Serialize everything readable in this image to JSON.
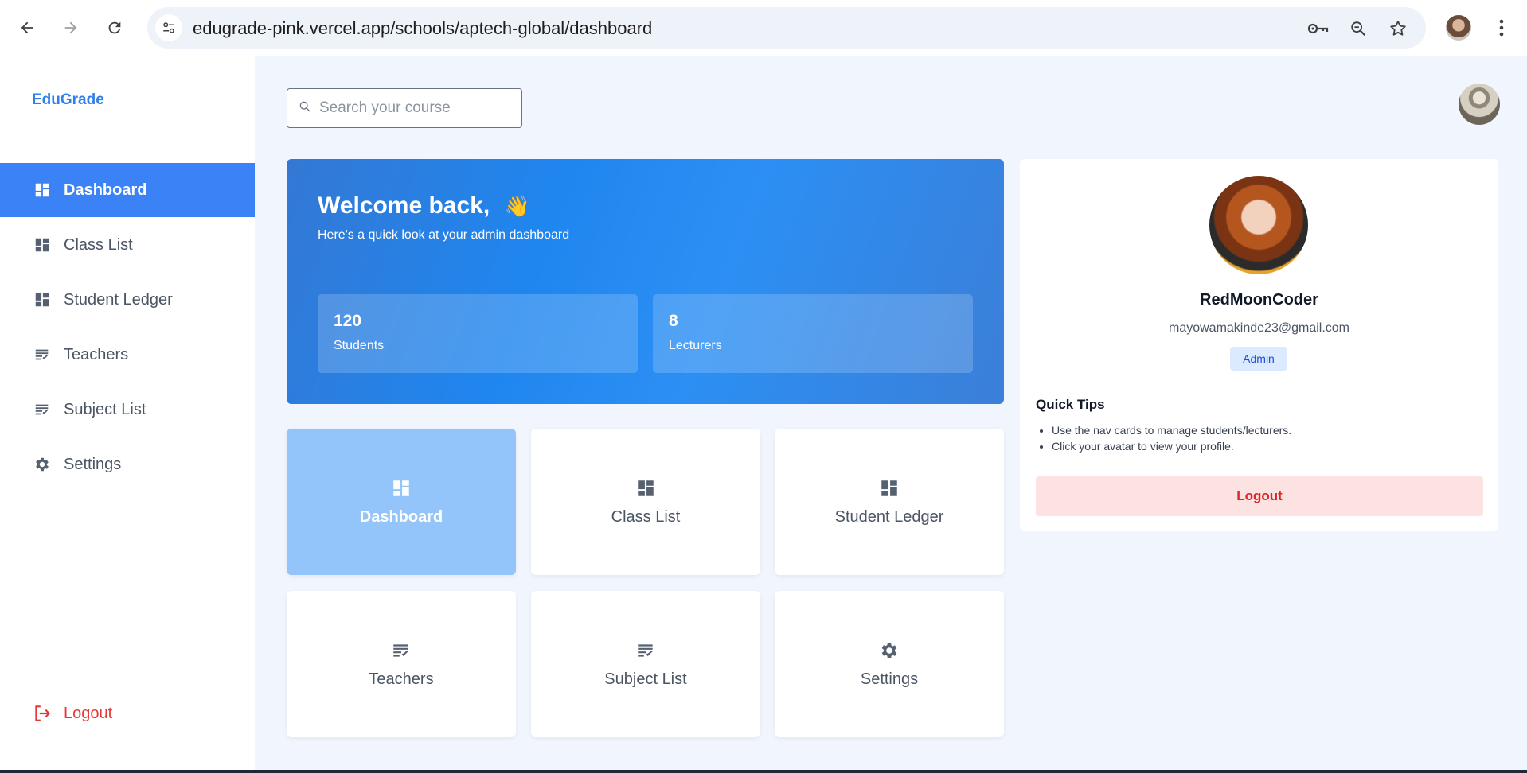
{
  "browser": {
    "url": "edugrade-pink.vercel.app/schools/aptech-global/dashboard",
    "icons": [
      "back-icon",
      "forward-icon",
      "reload-icon",
      "site-settings-icon",
      "password-key-icon",
      "zoom-icon",
      "bookmark-star-icon",
      "profile-avatar",
      "menu-kebab-icon"
    ]
  },
  "sidebar": {
    "brand": "EduGrade",
    "items": [
      {
        "label": "Dashboard",
        "icon": "dashboard-icon",
        "active": true
      },
      {
        "label": "Class List",
        "icon": "dashboard-icon",
        "active": false
      },
      {
        "label": "Student Ledger",
        "icon": "dashboard-icon",
        "active": false
      },
      {
        "label": "Teachers",
        "icon": "list-check-icon",
        "active": false
      },
      {
        "label": "Subject List",
        "icon": "list-check-icon",
        "active": false
      },
      {
        "label": "Settings",
        "icon": "gear-icon",
        "active": false
      }
    ],
    "logout": "Logout"
  },
  "search": {
    "placeholder": "Search your course",
    "value": ""
  },
  "welcome": {
    "title": "Welcome back,",
    "emoji": "👋",
    "subtitle": "Here's a quick look at your admin dashboard",
    "stats": [
      {
        "value": "120",
        "label": "Students"
      },
      {
        "value": "8",
        "label": "Lecturers"
      }
    ]
  },
  "tiles": [
    {
      "label": "Dashboard",
      "icon": "dashboard-icon",
      "active": true
    },
    {
      "label": "Class List",
      "icon": "dashboard-icon",
      "active": false
    },
    {
      "label": "Student Ledger",
      "icon": "dashboard-icon",
      "active": false
    },
    {
      "label": "Teachers",
      "icon": "list-check-icon",
      "active": false
    },
    {
      "label": "Subject List",
      "icon": "list-check-icon",
      "active": false
    },
    {
      "label": "Settings",
      "icon": "gear-icon",
      "active": false
    }
  ],
  "profile": {
    "name": "RedMoonCoder",
    "email": "mayowamakinde23@gmail.com",
    "role": "Admin",
    "tips_title": "Quick Tips",
    "tips": [
      "Use the nav cards to manage students/lecturers.",
      "Click your avatar to view your profile."
    ],
    "logout": "Logout"
  },
  "colors": {
    "accent": "#3b82f6",
    "brand": "#2f80ed",
    "tile_active": "#93c5fb",
    "logout_red": "#e53935",
    "badge_bg": "#dbeafe"
  }
}
